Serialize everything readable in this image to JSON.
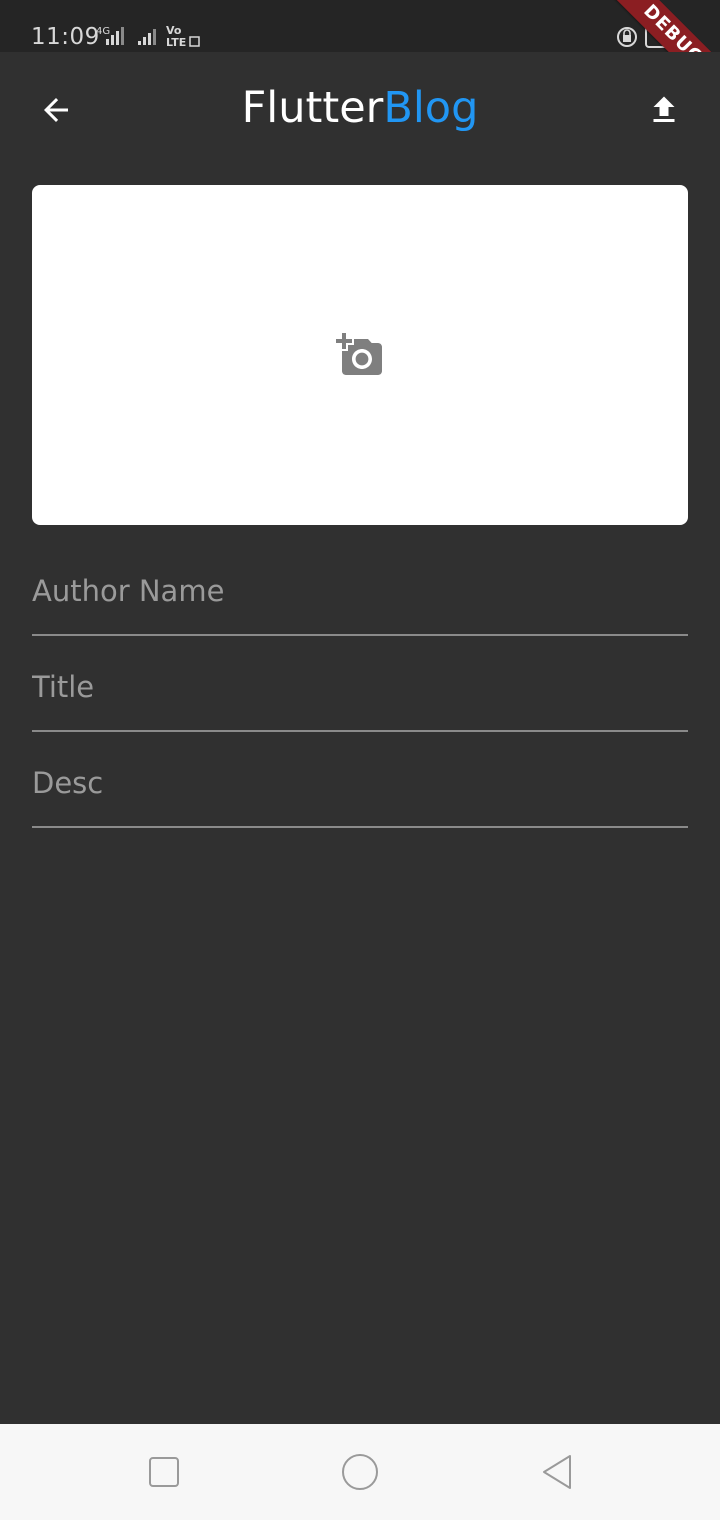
{
  "status_bar": {
    "time": "11:09",
    "network_label": "4G",
    "volte_label": "Vo LTE"
  },
  "debug_banner": {
    "label": "DEBUG",
    "color": "#8b1e22"
  },
  "app_bar": {
    "title_part_1": "Flutter",
    "title_part_2": "Blog",
    "title_part_2_color": "#2196f3",
    "back_icon": "arrow-back-icon",
    "action_icon": "upload-icon"
  },
  "image_picker": {
    "icon": "add-a-photo-icon"
  },
  "form": {
    "author_placeholder": "Author Name",
    "author_value": "",
    "title_placeholder": "Title",
    "title_value": "",
    "desc_placeholder": "Desc",
    "desc_value": ""
  },
  "nav_bar": {
    "recent_icon": "square-icon",
    "home_icon": "circle-icon",
    "back_icon": "triangle-back-icon"
  },
  "colors": {
    "background": "#303030",
    "accent": "#2196f3"
  }
}
